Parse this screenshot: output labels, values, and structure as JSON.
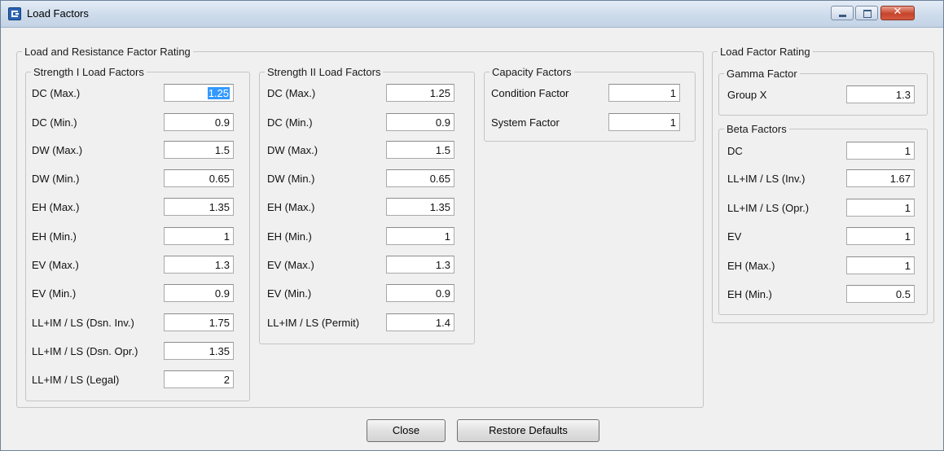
{
  "window": {
    "title": "Load Factors"
  },
  "lrfr": {
    "title": "Load and Resistance Factor Rating"
  },
  "strength1": {
    "title": "Strength I Load Factors",
    "rows": [
      {
        "label": "DC (Max.)",
        "value": "1.25"
      },
      {
        "label": "DC (Min.)",
        "value": "0.9"
      },
      {
        "label": "DW (Max.)",
        "value": "1.5"
      },
      {
        "label": "DW (Min.)",
        "value": "0.65"
      },
      {
        "label": "EH (Max.)",
        "value": "1.35"
      },
      {
        "label": "EH (Min.)",
        "value": "1"
      },
      {
        "label": "EV (Max.)",
        "value": "1.3"
      },
      {
        "label": "EV (Min.)",
        "value": "0.9"
      },
      {
        "label": "LL+IM / LS (Dsn. Inv.)",
        "value": "1.75"
      },
      {
        "label": "LL+IM / LS (Dsn. Opr.)",
        "value": "1.35"
      },
      {
        "label": "LL+IM / LS (Legal)",
        "value": "2"
      }
    ]
  },
  "strength2": {
    "title": "Strength II Load Factors",
    "rows": [
      {
        "label": "DC (Max.)",
        "value": "1.25"
      },
      {
        "label": "DC (Min.)",
        "value": "0.9"
      },
      {
        "label": "DW (Max.)",
        "value": "1.5"
      },
      {
        "label": "DW (Min.)",
        "value": "0.65"
      },
      {
        "label": "EH (Max.)",
        "value": "1.35"
      },
      {
        "label": "EH (Min.)",
        "value": "1"
      },
      {
        "label": "EV (Max.)",
        "value": "1.3"
      },
      {
        "label": "EV (Min.)",
        "value": "0.9"
      },
      {
        "label": "LL+IM / LS (Permit)",
        "value": "1.4"
      }
    ]
  },
  "capacity": {
    "title": "Capacity Factors",
    "rows": [
      {
        "label": "Condition Factor",
        "value": "1"
      },
      {
        "label": "System Factor",
        "value": "1"
      }
    ]
  },
  "lfr": {
    "title": "Load Factor Rating"
  },
  "gamma": {
    "title": "Gamma Factor",
    "rows": [
      {
        "label": "Group X",
        "value": "1.3"
      }
    ]
  },
  "beta": {
    "title": "Beta Factors",
    "rows": [
      {
        "label": "DC",
        "value": "1"
      },
      {
        "label": "LL+IM / LS (Inv.)",
        "value": "1.67"
      },
      {
        "label": "LL+IM / LS (Opr.)",
        "value": "1"
      },
      {
        "label": "EV",
        "value": "1"
      },
      {
        "label": "EH (Max.)",
        "value": "1"
      },
      {
        "label": "EH (Min.)",
        "value": "0.5"
      }
    ]
  },
  "buttons": {
    "close": "Close",
    "restore": "Restore Defaults"
  }
}
